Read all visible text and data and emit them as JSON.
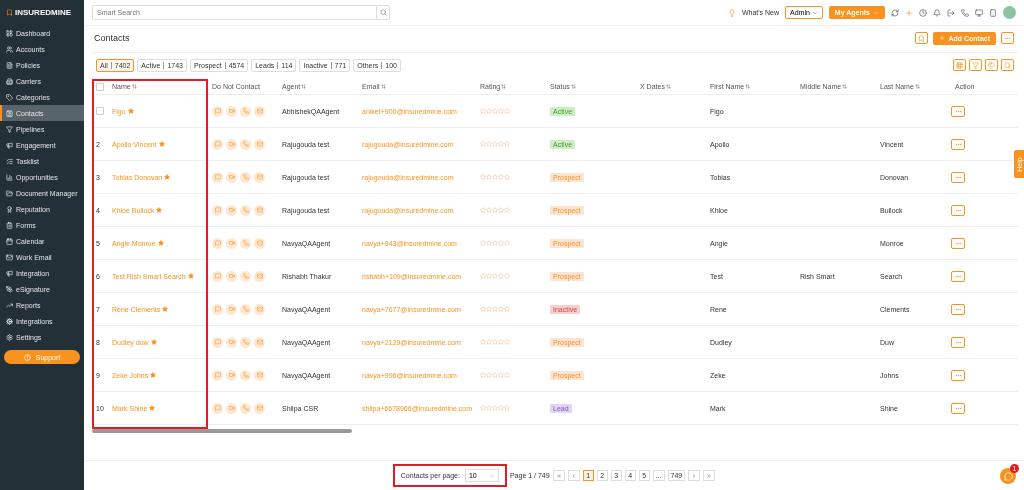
{
  "sidebar": {
    "logo": "INSUREDMINE",
    "items": [
      {
        "label": "Dashboard",
        "selected": false
      },
      {
        "label": "Accounts",
        "selected": false
      },
      {
        "label": "Policies",
        "selected": false
      },
      {
        "label": "Carriers",
        "selected": false
      },
      {
        "label": "Categories",
        "selected": false
      },
      {
        "label": "Contacts",
        "selected": true
      },
      {
        "label": "Pipelines",
        "selected": false
      },
      {
        "label": "Engagement",
        "selected": false
      },
      {
        "label": "Tasklist",
        "selected": false
      },
      {
        "label": "Opportunities",
        "selected": false
      },
      {
        "label": "Document Manager",
        "selected": false
      },
      {
        "label": "Reputation",
        "selected": false
      },
      {
        "label": "Forms",
        "selected": false
      },
      {
        "label": "Calendar",
        "selected": false
      },
      {
        "label": "Work Email",
        "selected": false
      },
      {
        "label": "Integration",
        "selected": false
      },
      {
        "label": "eSignature",
        "selected": false
      },
      {
        "label": "Reports",
        "selected": false
      },
      {
        "label": "Integrations",
        "selected": false
      },
      {
        "label": "Settings",
        "selected": false
      }
    ],
    "support": "Support"
  },
  "topbar": {
    "search_placeholder": "Smart Search",
    "whats_new": "What's New",
    "role": "Admin",
    "agents_button": "My Agents"
  },
  "page": {
    "title": "Contacts",
    "add_button": "Add Contact"
  },
  "filters": [
    {
      "label": "All",
      "count": "7402",
      "selected": true
    },
    {
      "label": "Active",
      "count": "1743",
      "selected": false
    },
    {
      "label": "Prospect",
      "count": "4574",
      "selected": false
    },
    {
      "label": "Leads",
      "count": "114",
      "selected": false
    },
    {
      "label": "Inactive",
      "count": "771",
      "selected": false
    },
    {
      "label": "Others",
      "count": "100",
      "selected": false
    }
  ],
  "table": {
    "all_checked": false,
    "columns": [
      {
        "label": "Name",
        "sortable": true
      },
      {
        "label": "Do Not Contact",
        "sortable": false
      },
      {
        "label": "Agent",
        "sortable": true
      },
      {
        "label": "Email",
        "sortable": true
      },
      {
        "label": "Rating",
        "sortable": true
      },
      {
        "label": "Status",
        "sortable": true
      },
      {
        "label": "X Dates",
        "sortable": true
      },
      {
        "label": "First Name",
        "sortable": true
      },
      {
        "label": "Middle Name",
        "sortable": true
      },
      {
        "label": "Last Name",
        "sortable": true
      },
      {
        "label": "Action",
        "sortable": false
      }
    ],
    "rows": [
      {
        "index": "",
        "checked": false,
        "name": "Figo",
        "agent": "AbhishekQAAgent",
        "email": "aniket+900@insuredmine.com",
        "status": {
          "label": "Active",
          "color": "#cdeec4"
        },
        "first": "Figo",
        "middle": "",
        "last": ""
      },
      {
        "index": "2",
        "name": "Apollo Vincent",
        "agent": "Rajugouda test",
        "email": "rajugouda@insuredmine.com",
        "status": {
          "label": "Active",
          "color": "#cdeec4"
        },
        "first": "Apollo",
        "middle": "",
        "last": "Vincent"
      },
      {
        "index": "3",
        "name": "Tobias Donovan",
        "agent": "Rajugouda test",
        "email": "rajugouda@insuredmine.com",
        "status": {
          "label": "Prospect",
          "color": "#fde5d6"
        },
        "first": "Tobias",
        "middle": "",
        "last": "Donovan"
      },
      {
        "index": "4",
        "name": "Khloe Bullock",
        "agent": "Rajugouda test",
        "email": "rajugouda@insuredmine.com",
        "status": {
          "label": "Prospect",
          "color": "#fde5d6"
        },
        "first": "Khloe",
        "middle": "",
        "last": "Bullock"
      },
      {
        "index": "5",
        "name": "Angie Monroe",
        "agent": "NavyaQAAgent",
        "email": "navya+943@insuredmine.com",
        "status": {
          "label": "Prospect",
          "color": "#fde5d6"
        },
        "first": "Angie",
        "middle": "",
        "last": "Monroe"
      },
      {
        "index": "6",
        "name": "Test Rish Smart Search",
        "agent": "Rishabh Thakur",
        "email": "rishabh+109@insuredmine.com",
        "status": {
          "label": "Prospect",
          "color": "#fde5d6"
        },
        "first": "Test",
        "middle": "Rish Smart",
        "last": "Search"
      },
      {
        "index": "7",
        "name": "Rene Clements",
        "agent": "NavyaQAAgent",
        "email": "navya+7677@insuredmine.com",
        "status": {
          "label": "Inactive",
          "color": "#f8cfcf"
        },
        "first": "Rene",
        "middle": "",
        "last": "Clements"
      },
      {
        "index": "8",
        "name": "Dudley duw",
        "agent": "NavyaQAAgent",
        "email": "navya+2129@insuredmine.com",
        "status": {
          "label": "Prospect",
          "color": "#fde5d6"
        },
        "first": "Dudley",
        "middle": "",
        "last": "Duw"
      },
      {
        "index": "9",
        "name": "Zeke Johns",
        "agent": "NavyaQAAgent",
        "email": "navya+996@insuredmine.com",
        "status": {
          "label": "Prospect",
          "color": "#fde5d6"
        },
        "first": "Zeke",
        "middle": "",
        "last": "Johns"
      },
      {
        "index": "10",
        "name": "Mark Shine",
        "agent": "Shilpa CSR",
        "email": "shilpa+6678966@insuredmine.com",
        "status": {
          "label": "Lead",
          "color": "#e2d5f5"
        },
        "first": "Mark",
        "middle": "",
        "last": "Shine"
      }
    ]
  },
  "pagination": {
    "per_page_label": "Contacts per page:",
    "per_page": "10",
    "page_info": "Page 1 / 749",
    "pages": [
      {
        "label": "1",
        "selected": true
      },
      {
        "label": "2",
        "selected": false
      },
      {
        "label": "3",
        "selected": false
      },
      {
        "label": "4",
        "selected": false
      },
      {
        "label": "5",
        "selected": false
      },
      {
        "label": "...",
        "selected": false
      },
      {
        "label": "749",
        "selected": false
      }
    ]
  },
  "help_tab": "Help",
  "chat_badge": "1"
}
